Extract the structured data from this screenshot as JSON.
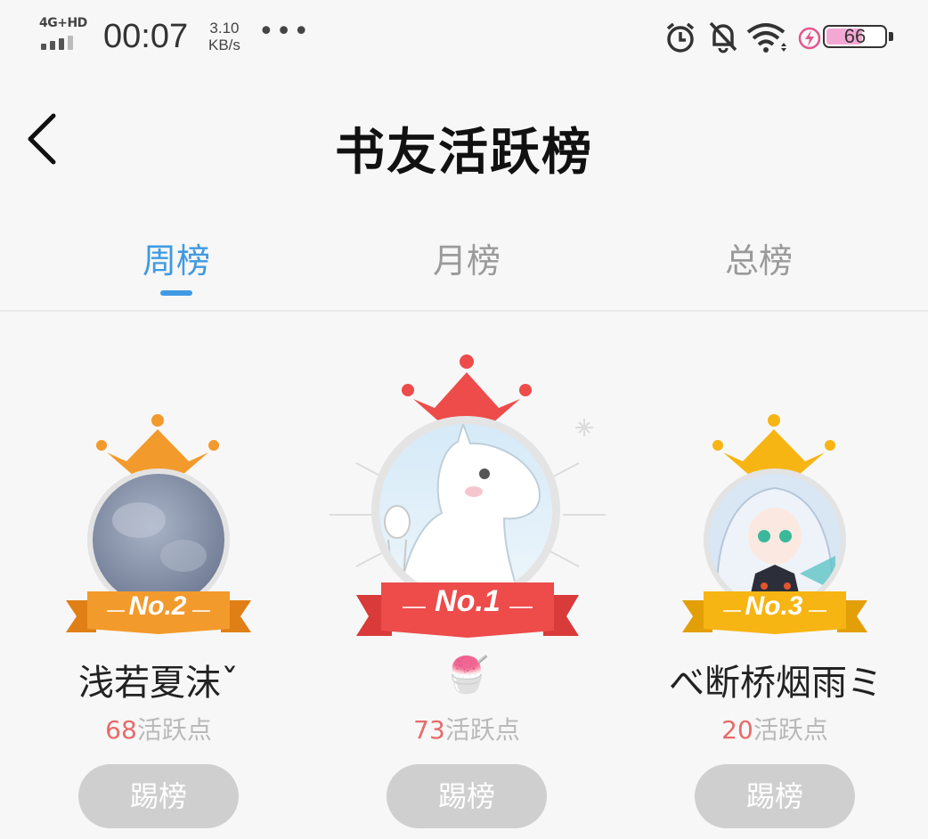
{
  "status_bar": {
    "network": "4G+HD",
    "time": "00:07",
    "speed_value": "3.10",
    "speed_unit": "KB/s",
    "more": "•••",
    "battery": "66",
    "icons": [
      "alarm-icon",
      "bell-off-icon",
      "wifi-icon",
      "charging-icon",
      "battery-icon"
    ]
  },
  "header": {
    "title": "书友活跃榜",
    "back_icon": "chevron-left-icon"
  },
  "tabs": [
    {
      "label": "周榜",
      "active": true
    },
    {
      "label": "月榜",
      "active": false
    },
    {
      "label": "总榜",
      "active": false
    }
  ],
  "leaderboard": [
    {
      "rank": "No.2",
      "name": "浅若夏沫ˇ",
      "points": "68",
      "points_suffix": "活跃点",
      "button": "踢榜",
      "color": "#f39a2c"
    },
    {
      "rank": "No.1",
      "name": "🍧",
      "points": "73",
      "points_suffix": "活跃点",
      "button": "踢榜",
      "color": "#ee4b4b"
    },
    {
      "rank": "No.3",
      "name": "べ断桥烟雨ミ",
      "points": "20",
      "points_suffix": "活跃点",
      "button": "踢榜",
      "color": "#f7b514"
    }
  ],
  "colors": {
    "accent": "#3f9ae3",
    "points": "#e86a6a",
    "button_bg": "#cfcfcf"
  }
}
